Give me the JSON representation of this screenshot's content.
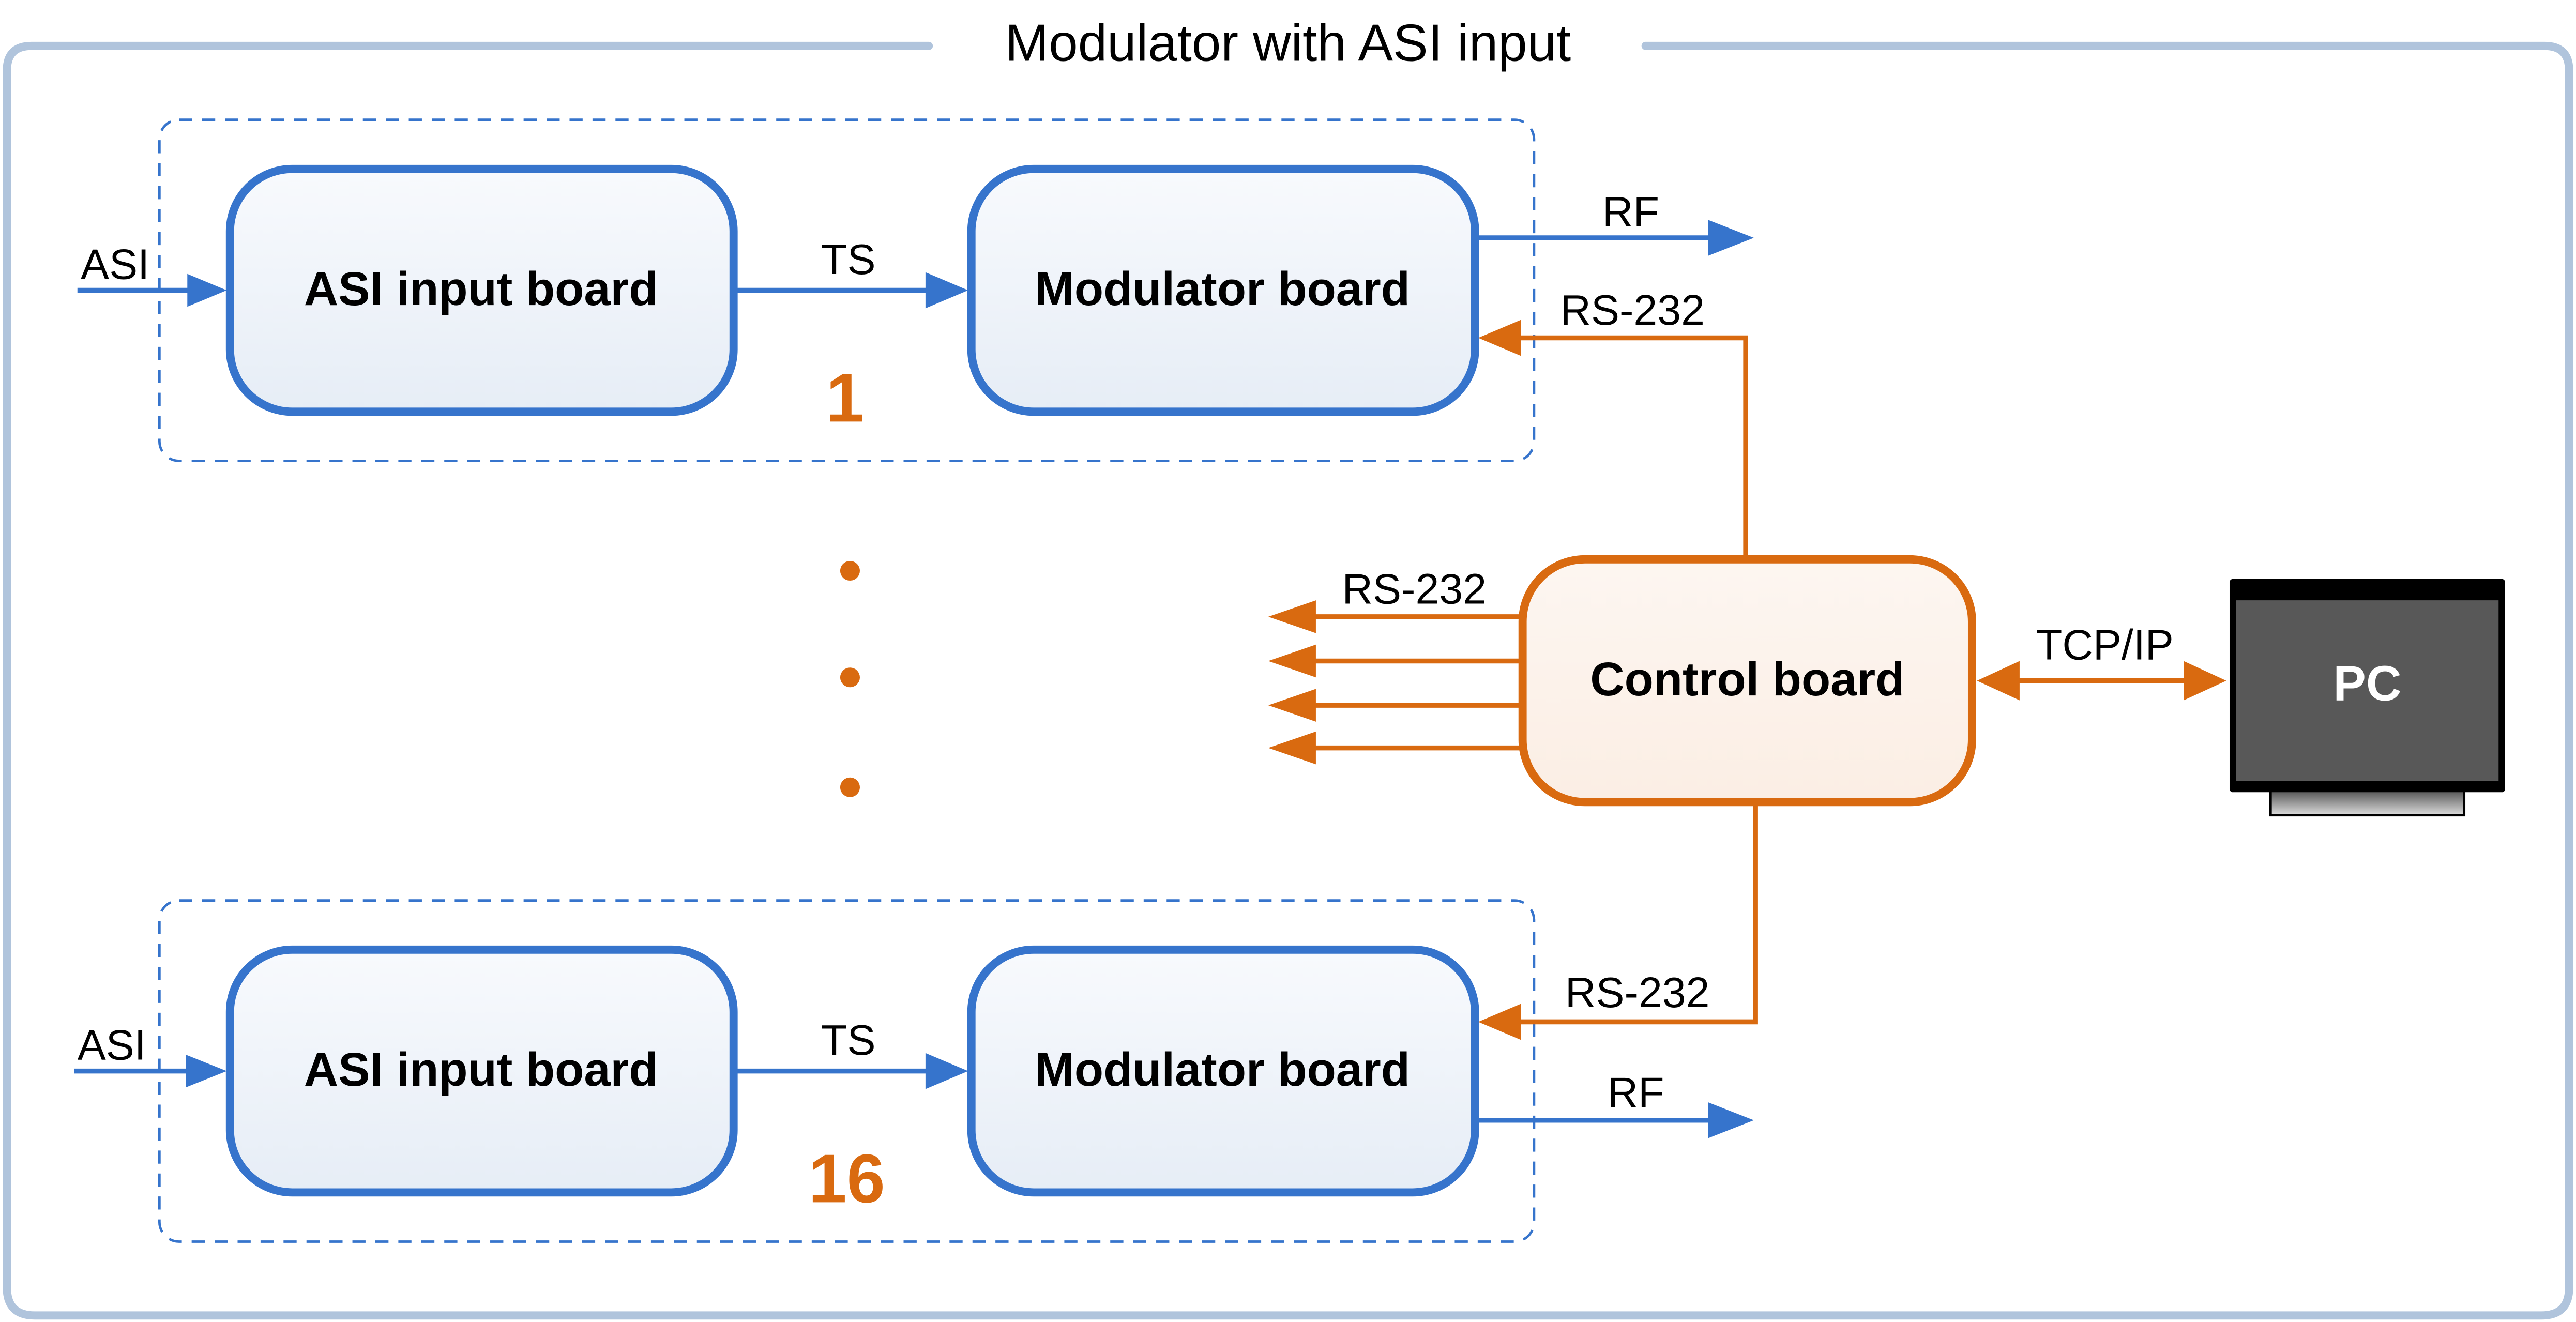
{
  "title": "Modulator with ASI input",
  "colors": {
    "frame": "#b0c4dc",
    "blue": "#3674cc",
    "orange": "#d96a10",
    "box_fill_top": "#f8fafd",
    "box_fill_bottom": "#e6edf6",
    "control_fill": "#fcf1e9",
    "pc_screen": "#555555"
  },
  "channels": [
    {
      "number": "1",
      "input_label": "ASI",
      "input_board": "ASI input board",
      "link_label": "TS",
      "modulator_board": "Modulator board",
      "output_label": "RF",
      "control_label": "RS-232"
    },
    {
      "number": "16",
      "input_label": "ASI",
      "input_board": "ASI input board",
      "link_label": "TS",
      "modulator_board": "Modulator board",
      "output_label": "RF",
      "control_label": "RS-232"
    }
  ],
  "control": {
    "label": "Control board",
    "fanout_label": "RS-232",
    "fanout_count": 4
  },
  "pc": {
    "label": "PC",
    "link_label": "TCP/IP"
  }
}
